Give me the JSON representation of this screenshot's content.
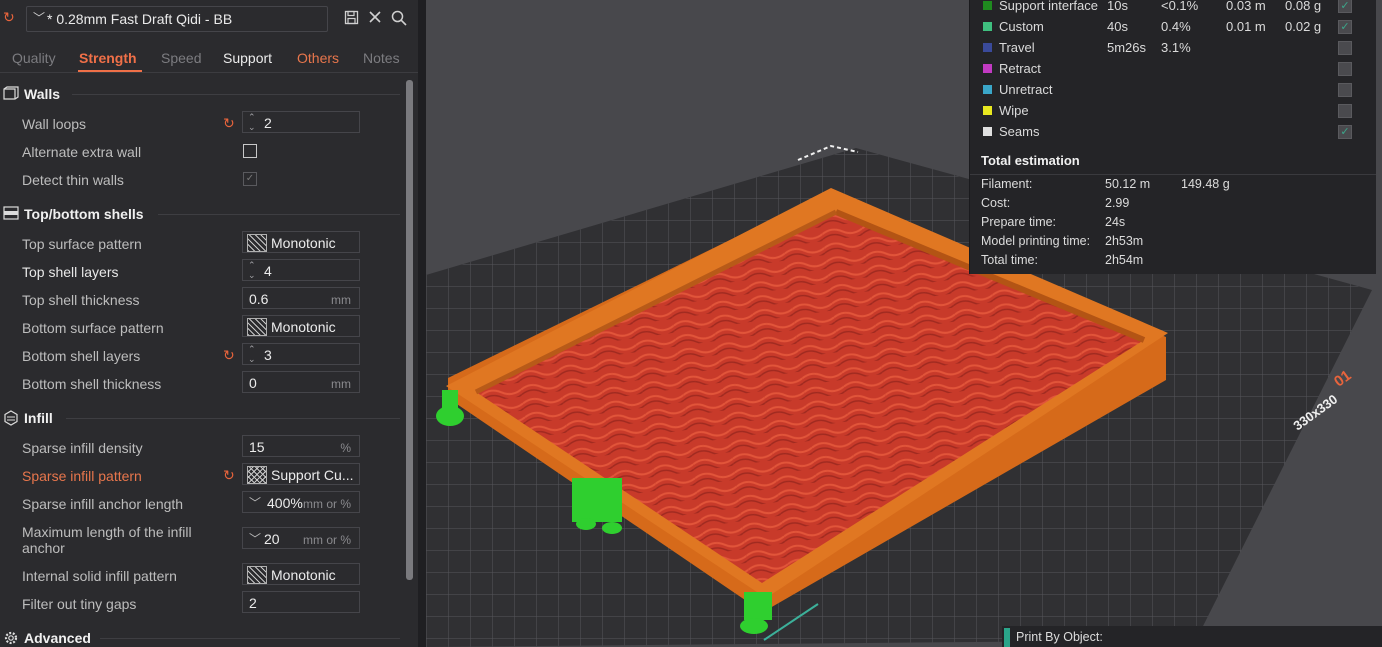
{
  "preset": {
    "name": "* 0.28mm Fast Draft Qidi - BB",
    "chevron": "﹀"
  },
  "toolbar": {
    "save_icon": "save-icon",
    "close_icon": "close-icon",
    "search_icon": "search-icon"
  },
  "tabs": [
    {
      "label": "Quality"
    },
    {
      "label": "Strength"
    },
    {
      "label": "Speed"
    },
    {
      "label": "Support"
    },
    {
      "label": "Others"
    },
    {
      "label": "Notes"
    }
  ],
  "sections": {
    "walls": "Walls",
    "shells": "Top/bottom shells",
    "infill": "Infill",
    "advanced": "Advanced"
  },
  "settings": {
    "wall_loops": {
      "label": "Wall loops",
      "value": "2"
    },
    "alt_extra_wall": {
      "label": "Alternate extra wall"
    },
    "detect_thin": {
      "label": "Detect thin walls",
      "check": "✓"
    },
    "top_surface_pattern": {
      "label": "Top surface pattern",
      "value": "Monotonic"
    },
    "top_shell_layers": {
      "label": "Top shell layers",
      "value": "4"
    },
    "top_shell_thickness": {
      "label": "Top shell thickness",
      "value": "0.6",
      "unit": "mm"
    },
    "bottom_surface_pattern": {
      "label": "Bottom surface pattern",
      "value": "Monotonic"
    },
    "bottom_shell_layers": {
      "label": "Bottom shell layers",
      "value": "3"
    },
    "bottom_shell_thickness": {
      "label": "Bottom shell thickness",
      "value": "0",
      "unit": "mm"
    },
    "sparse_density": {
      "label": "Sparse infill density",
      "value": "15",
      "unit": "%"
    },
    "sparse_pattern": {
      "label": "Sparse infill pattern",
      "value": "Support Cu..."
    },
    "anchor_length": {
      "label": "Sparse infill anchor length",
      "value": "400%",
      "unit": "mm or %"
    },
    "max_anchor": {
      "label": "Maximum length of the infill anchor",
      "value": "20",
      "unit": "mm or %"
    },
    "internal_solid": {
      "label": "Internal solid infill pattern",
      "value": "Monotonic"
    },
    "filter_gaps": {
      "label": "Filter out tiny gaps",
      "value": "2"
    }
  },
  "legend": [
    {
      "name": "Support interface",
      "c1": "10s",
      "c2": "<0.1%",
      "c3": "0.03 m",
      "c4": "0.08 g",
      "color": "#1f8a1f",
      "checked": true
    },
    {
      "name": "Custom",
      "c1": "40s",
      "c2": "0.4%",
      "c3": "0.01 m",
      "c4": "0.02 g",
      "color": "#3fbf7f",
      "checked": true
    },
    {
      "name": "Travel",
      "c1": "5m26s",
      "c2": "3.1%",
      "c3": "",
      "c4": "",
      "color": "#3a4a9a",
      "checked": false
    },
    {
      "name": "Retract",
      "c1": "",
      "c2": "",
      "c3": "",
      "c4": "",
      "color": "#c23ac2",
      "checked": false
    },
    {
      "name": "Unretract",
      "c1": "",
      "c2": "",
      "c3": "",
      "c4": "",
      "color": "#3aa6c8",
      "checked": false
    },
    {
      "name": "Wipe",
      "c1": "",
      "c2": "",
      "c3": "",
      "c4": "",
      "color": "#e8e820",
      "checked": false
    },
    {
      "name": "Seams",
      "c1": "",
      "c2": "",
      "c3": "",
      "c4": "",
      "color": "#e0e0e0",
      "checked": true
    }
  ],
  "check_mark": "✓",
  "total": {
    "title": "Total estimation",
    "filament_label": "Filament:",
    "filament_len": "50.12 m",
    "filament_weight": "149.48 g",
    "cost_label": "Cost:",
    "cost": "2.99",
    "prepare_label": "Prepare time:",
    "prepare": "24s",
    "model_label": "Model printing time:",
    "model": "2h53m",
    "total_label": "Total time:",
    "total_time": "2h54m"
  },
  "plate": {
    "size_label": "330x330",
    "number": "01"
  },
  "bottom": {
    "label": "Print By Object:"
  }
}
